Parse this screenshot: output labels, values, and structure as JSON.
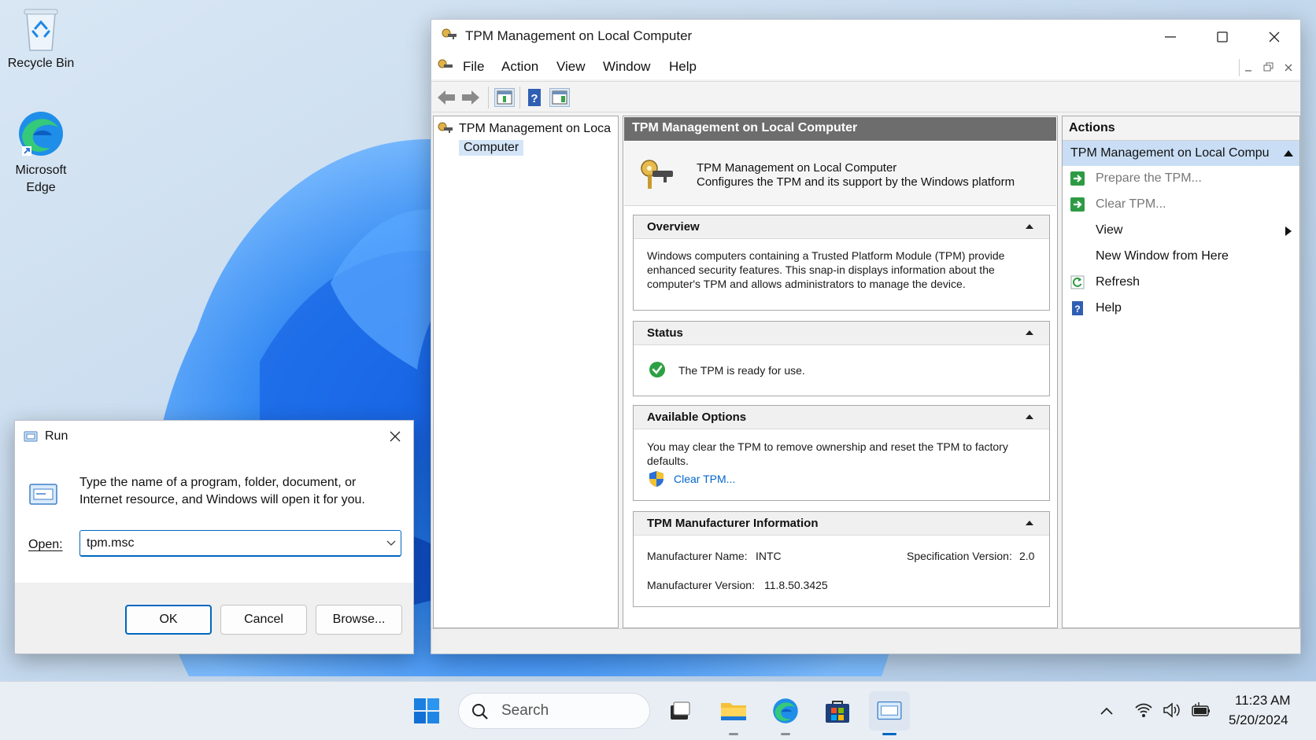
{
  "desktop": {
    "icons": [
      {
        "label": "Recycle Bin"
      },
      {
        "label": "Microsoft Edge"
      }
    ]
  },
  "tpm_window": {
    "title": "TPM Management on Local Computer",
    "menu": [
      "File",
      "Action",
      "View",
      "Window",
      "Help"
    ],
    "tree": {
      "root_line1": "TPM Management on Loca",
      "root_line2": "Computer"
    },
    "center": {
      "header": "TPM Management on Local Computer",
      "intro_title": "TPM Management on Local Computer",
      "intro_desc": "Configures the TPM and its support by the Windows platform",
      "overview": {
        "title": "Overview",
        "text": "Windows computers containing a Trusted Platform Module (TPM) provide enhanced security features. This snap-in displays information about the computer's TPM and allows administrators to manage the device."
      },
      "status": {
        "title": "Status",
        "text": "The TPM is ready for use."
      },
      "available_options": {
        "title": "Available Options",
        "text": "You may clear the TPM to remove ownership and reset the TPM to factory defaults.",
        "link": "Clear TPM..."
      },
      "manufacturer": {
        "title": "TPM Manufacturer Information",
        "name_label": "Manufacturer Name:",
        "name_value": "INTC",
        "spec_label": "Specification Version:",
        "spec_value": "2.0",
        "version_label": "Manufacturer Version:",
        "version_value": "11.8.50.3425"
      }
    },
    "actions": {
      "header": "Actions",
      "subheader": "TPM Management on Local Compu",
      "items": [
        {
          "label": "Prepare the TPM..."
        },
        {
          "label": "Clear TPM..."
        },
        {
          "label": "View"
        },
        {
          "label": "New Window from Here"
        },
        {
          "label": "Refresh"
        },
        {
          "label": "Help"
        }
      ]
    }
  },
  "run_dialog": {
    "title": "Run",
    "description": "Type the name of a program, folder, document, or Internet resource, and Windows will open it for you.",
    "open_label": "Open:",
    "open_value": "tpm.msc",
    "ok": "OK",
    "cancel": "Cancel",
    "browse": "Browse..."
  },
  "taskbar": {
    "search_placeholder": "Search",
    "time": "11:23 AM",
    "date": "5/20/2024"
  },
  "colors": {
    "accent": "#0067c0",
    "wallpaper": "#c8dcef",
    "pane_header": "#6d6d6d",
    "action_selected": "#c9def5",
    "status_green": "#2ea043"
  }
}
